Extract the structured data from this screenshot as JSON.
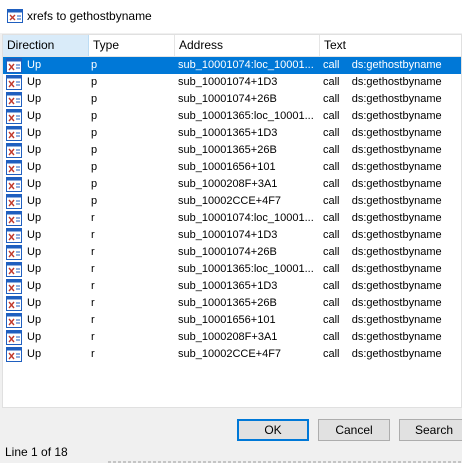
{
  "window": {
    "title": "xrefs to gethostbyname",
    "icon": "xrefs-window-icon"
  },
  "columns": [
    "Direction",
    "Type",
    "Address",
    "Text"
  ],
  "sorted_column": "Direction",
  "rows": [
    {
      "direction": "Up",
      "type": "p",
      "address": "sub_10001074:loc_10001...",
      "text": "call    ds:gethostbyname",
      "selected": true
    },
    {
      "direction": "Up",
      "type": "p",
      "address": "sub_10001074+1D3",
      "text": "call    ds:gethostbyname"
    },
    {
      "direction": "Up",
      "type": "p",
      "address": "sub_10001074+26B",
      "text": "call    ds:gethostbyname"
    },
    {
      "direction": "Up",
      "type": "p",
      "address": "sub_10001365:loc_10001...",
      "text": "call    ds:gethostbyname"
    },
    {
      "direction": "Up",
      "type": "p",
      "address": "sub_10001365+1D3",
      "text": "call    ds:gethostbyname"
    },
    {
      "direction": "Up",
      "type": "p",
      "address": "sub_10001365+26B",
      "text": "call    ds:gethostbyname"
    },
    {
      "direction": "Up",
      "type": "p",
      "address": "sub_10001656+101",
      "text": "call    ds:gethostbyname"
    },
    {
      "direction": "Up",
      "type": "p",
      "address": "sub_1000208F+3A1",
      "text": "call    ds:gethostbyname"
    },
    {
      "direction": "Up",
      "type": "p",
      "address": "sub_10002CCE+4F7",
      "text": "call    ds:gethostbyname"
    },
    {
      "direction": "Up",
      "type": "r",
      "address": "sub_10001074:loc_10001...",
      "text": "call    ds:gethostbyname"
    },
    {
      "direction": "Up",
      "type": "r",
      "address": "sub_10001074+1D3",
      "text": "call    ds:gethostbyname"
    },
    {
      "direction": "Up",
      "type": "r",
      "address": "sub_10001074+26B",
      "text": "call    ds:gethostbyname"
    },
    {
      "direction": "Up",
      "type": "r",
      "address": "sub_10001365:loc_10001...",
      "text": "call    ds:gethostbyname"
    },
    {
      "direction": "Up",
      "type": "r",
      "address": "sub_10001365+1D3",
      "text": "call    ds:gethostbyname"
    },
    {
      "direction": "Up",
      "type": "r",
      "address": "sub_10001365+26B",
      "text": "call    ds:gethostbyname"
    },
    {
      "direction": "Up",
      "type": "r",
      "address": "sub_10001656+101",
      "text": "call    ds:gethostbyname"
    },
    {
      "direction": "Up",
      "type": "r",
      "address": "sub_1000208F+3A1",
      "text": "call    ds:gethostbyname"
    },
    {
      "direction": "Up",
      "type": "r",
      "address": "sub_10002CCE+4F7",
      "text": "call    ds:gethostbyname"
    }
  ],
  "buttons": {
    "ok": "OK",
    "cancel": "Cancel",
    "search": "Search"
  },
  "status": {
    "text": "Line 1 of 18"
  },
  "colors": {
    "selection": "#0078d7",
    "sorted_header": "#d9ebf9",
    "icon_blue": "#1f5fbf"
  }
}
